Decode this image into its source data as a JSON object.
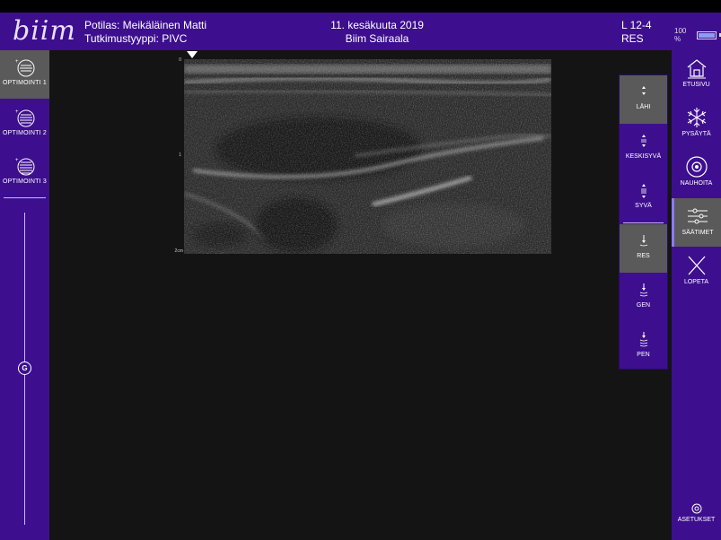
{
  "header": {
    "logo": "biim",
    "patient_line": "Potilas: Meikäläinen Matti",
    "exam_type_line": "Tutkimustyyppi: PIVC",
    "date": "11. kesäkuuta 2019",
    "hospital": "Biim Sairaala",
    "probe": "L 12-4",
    "mode": "RES",
    "battery": "100 %"
  },
  "left_sidebar": {
    "items": [
      {
        "label": "OPTIMOINTI 1",
        "icon": "optimize-icon"
      },
      {
        "label": "OPTIMOINTI 2",
        "icon": "optimize-icon"
      },
      {
        "label": "OPTIMOINTI 3",
        "icon": "optimize-icon"
      }
    ],
    "gain_label": "G"
  },
  "scan": {
    "depth_labels": [
      "0",
      "1",
      "2cm"
    ]
  },
  "depth_panel": {
    "items": [
      {
        "label": "LÄHI",
        "icon": "depth-near-icon"
      },
      {
        "label": "KESKISYVÄ",
        "icon": "depth-mid-icon"
      },
      {
        "label": "SYVÄ",
        "icon": "depth-deep-icon"
      },
      {
        "label": "RES",
        "icon": "res-icon"
      },
      {
        "label": "GEN",
        "icon": "gen-icon"
      },
      {
        "label": "PEN",
        "icon": "pen-icon"
      }
    ]
  },
  "right_sidebar": {
    "items": [
      {
        "label": "ETUSIVU",
        "icon": "home-icon"
      },
      {
        "label": "PYSÄYTÄ",
        "icon": "freeze-icon"
      },
      {
        "label": "NAUHOITA",
        "icon": "record-icon"
      },
      {
        "label": "SÄÄTIMET",
        "icon": "sliders-icon"
      },
      {
        "label": "LOPETA",
        "icon": "close-icon"
      }
    ],
    "settings_label": "ASETUKSET"
  },
  "colors": {
    "brand_purple": "#3d0f8f",
    "active_gray": "#5a5a5a",
    "background": "#141414"
  }
}
